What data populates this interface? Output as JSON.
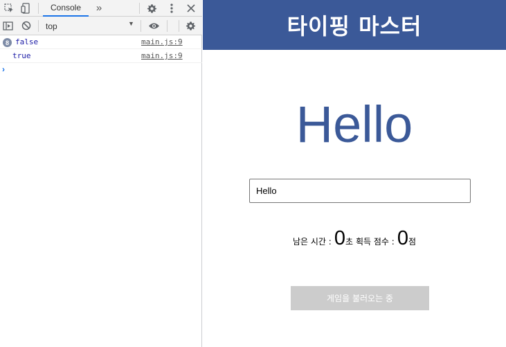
{
  "devtools": {
    "tabs": {
      "active": "Console",
      "more": "»"
    },
    "context": {
      "value": "top",
      "arrow": "▼"
    },
    "logs": [
      {
        "badge": "8",
        "value": "false",
        "source": "main.js:9"
      },
      {
        "badge": "",
        "value": "true",
        "source": "main.js:9"
      }
    ],
    "prompt": "›"
  },
  "app": {
    "title": "타이핑 마스터",
    "word": "Hello",
    "input_value": "Hello",
    "stats": {
      "time_label": "남은 시간 :",
      "time_value": "0",
      "time_unit": "초",
      "score_label": "획득 점수 :",
      "score_value": "0",
      "score_unit": "점"
    },
    "button_label": "게임을 불러오는 중",
    "colors": {
      "header": "#3b5998",
      "word": "#3b5998",
      "button": "#cccccc"
    }
  }
}
